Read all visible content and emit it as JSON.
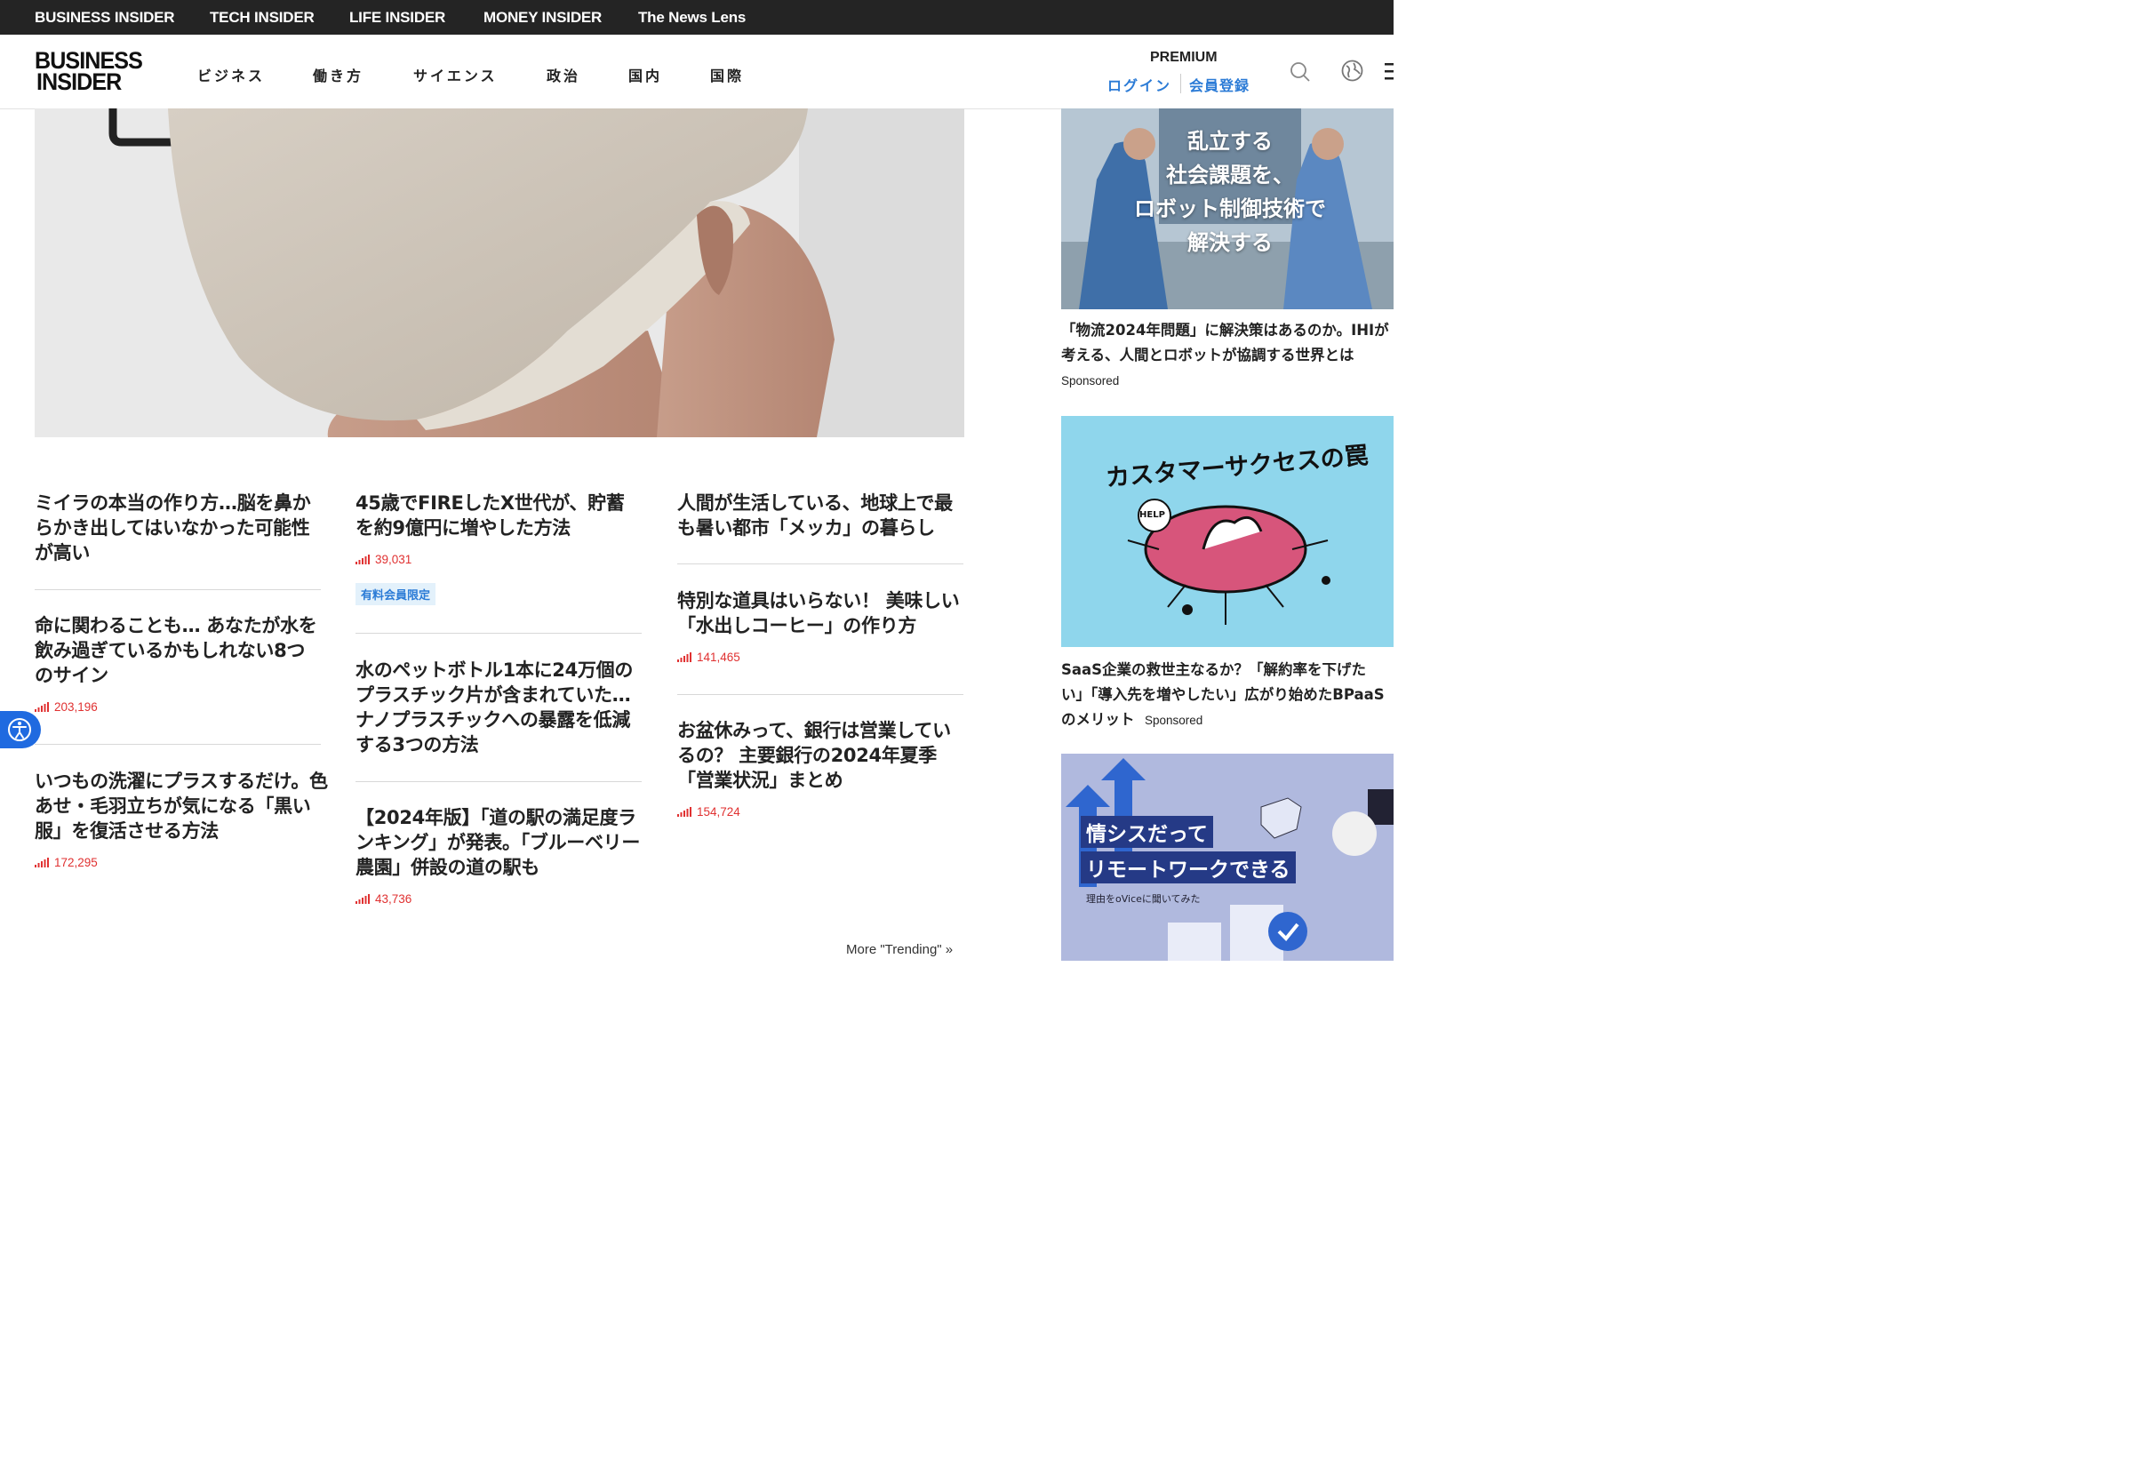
{
  "topbar": {
    "links": [
      "BUSINESS INSIDER",
      "TECH INSIDER",
      "LIFE INSIDER",
      "MONEY INSIDER",
      "The News Lens"
    ]
  },
  "header": {
    "logo_line1": "BUSINESS",
    "logo_line2": "INSIDER",
    "nav": [
      "ビジネス",
      "働き方",
      "サイエンス",
      "政治",
      "国内",
      "国際"
    ],
    "premium": "PREMIUM",
    "login": "ログイン",
    "signup": "会員登録"
  },
  "columns": [
    [
      {
        "title": "ミイラの本当の作り方…脳を鼻からかき出してはいなかった可能性が高い",
        "views": ""
      },
      {
        "title": "命に関わることも… あなたが水を飲み過ぎているかもしれない8つのサイン",
        "views": "203,196"
      },
      {
        "title": "いつもの洗濯にプラスするだけ。色あせ・毛羽立ちが気になる「黒い服」を復活させる方法",
        "views": "172,295"
      }
    ],
    [
      {
        "title": "45歳でFIREしたX世代が、貯蓄を約9億円に増やした方法",
        "views": "39,031",
        "badge": "有料会員限定"
      },
      {
        "title": "水のペットボトル1本に24万個のプラスチック片が含まれていた…ナノプラスチックへの暴露を低減する3つの方法",
        "views": ""
      },
      {
        "title": "【2024年版】「道の駅の満足度ランキング」が発表。「ブルーベリー農園」併設の道の駅も",
        "views": "43,736"
      }
    ],
    [
      {
        "title": "人間が生活している、地球上で最も暑い都市「メッカ」の暮らし",
        "views": ""
      },
      {
        "title": "特別な道具はいらない！ 美味しい「水出しコーヒー」の作り方",
        "views": "141,465"
      },
      {
        "title": "お盆休みって、銀行は営業しているの？ 主要銀行の2024年夏季「営業状況」まとめ",
        "views": "154,724"
      }
    ]
  ],
  "more_trending": "More \"Trending\" »",
  "sidebar": {
    "ad1": {
      "image_text": [
        "乱立する",
        "社会課題を、",
        "ロボット制御技術で",
        "解決する"
      ],
      "caption_line1": "「物流2024年問題」に解決策はあるのか。IHIが",
      "caption_line2": "考える、人間とロボットが協調する世界とは",
      "sponsored": "Sponsored"
    },
    "ad2": {
      "image_text": "カスタマーサクセスの罠",
      "help": "HELP",
      "caption_line1": "SaaS企業の救世主なるか？「解約率を下げた",
      "caption_line2": "い」「導入先を増やしたい」広がり始めたBPaaS",
      "caption_line3": "のメリット",
      "sponsored": "Sponsored"
    },
    "ad3": {
      "image_line1": "情シスだって",
      "image_line2": "リモートワークできる",
      "image_line3": "理由をoViceに聞いてみた"
    }
  },
  "colors": {
    "accent": "#2b7bd6",
    "views_red": "#e03131",
    "topbar": "#242424"
  }
}
